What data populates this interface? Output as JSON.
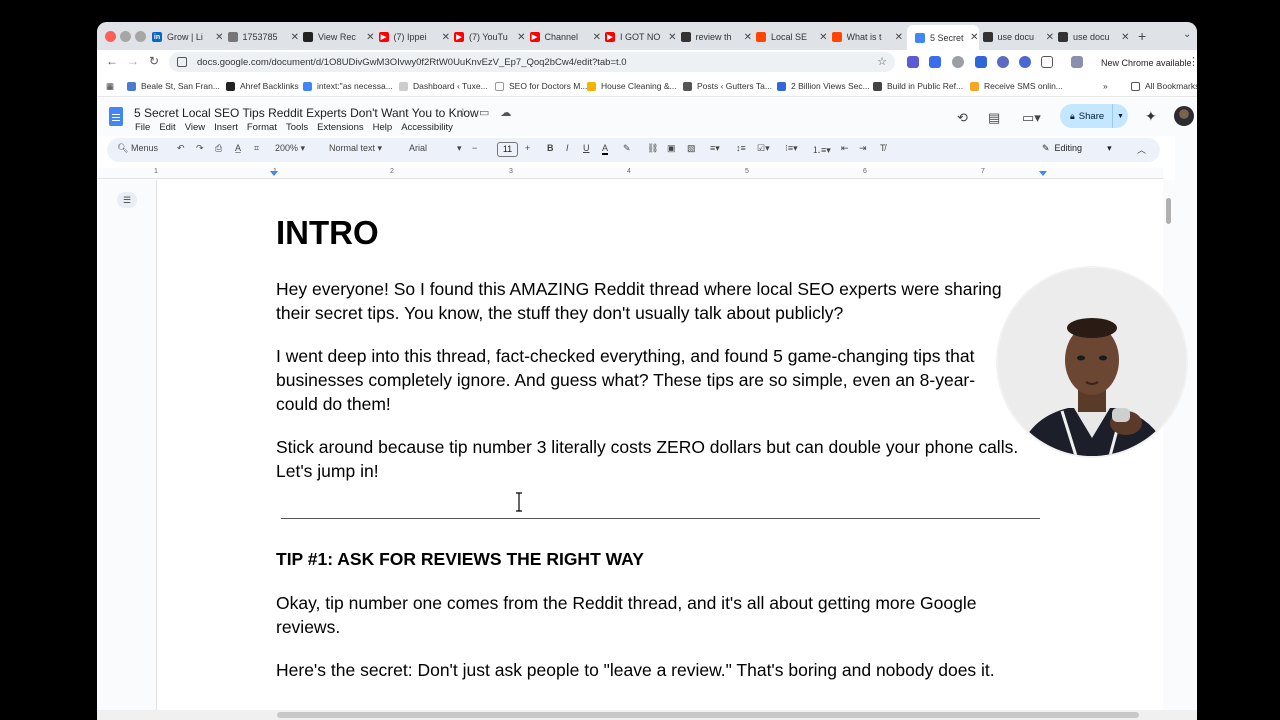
{
  "browser": {
    "tabs": [
      {
        "label": "Grow | Li",
        "icon": "linkedin-icon",
        "color": "#0a66c2",
        "glyph": "in"
      },
      {
        "label": "1753785",
        "icon": "globe-icon",
        "color": "#777777",
        "glyph": ""
      },
      {
        "label": "View Rec",
        "icon": "dark-site-icon",
        "color": "#222222",
        "glyph": ""
      },
      {
        "label": "(7) Ippei",
        "icon": "youtube-icon",
        "color": "#ff0000",
        "glyph": "▶"
      },
      {
        "label": "(7) YouTu",
        "icon": "youtube-icon",
        "color": "#ff0000",
        "glyph": "▶"
      },
      {
        "label": "Channel",
        "icon": "youtube-icon",
        "color": "#ff0000",
        "glyph": "▶"
      },
      {
        "label": "I GOT NO",
        "icon": "youtube-icon",
        "color": "#ff0000",
        "glyph": "▶"
      },
      {
        "label": "review th",
        "icon": "openai-icon",
        "color": "#333333",
        "glyph": ""
      },
      {
        "label": "Local SE",
        "icon": "reddit-icon",
        "color": "#ff4500",
        "glyph": ""
      },
      {
        "label": "What is t",
        "icon": "reddit-icon",
        "color": "#ff4500",
        "glyph": ""
      },
      {
        "label": "5 Secret",
        "icon": "google-docs-icon",
        "color": "#4285f4",
        "glyph": "",
        "active": true
      },
      {
        "label": "use docu",
        "icon": "openai-icon",
        "color": "#333333",
        "glyph": ""
      },
      {
        "label": "use docu",
        "icon": "openai-icon",
        "color": "#333333",
        "glyph": ""
      }
    ],
    "url": "docs.google.com/document/d/1O8UDivGwM3OIvwy0f2RtW0UuKnvEzV_Ep7_Qoq2bCw4/edit?tab=t.0",
    "update_label": "New Chrome available",
    "bookmarks": [
      {
        "label": "Beale St, San Fran...",
        "color": "#4a7bd0"
      },
      {
        "label": "Ahref Backlinks",
        "color": "#222222"
      },
      {
        "label": "intext:\"as necessa...",
        "color": "#4285f4"
      },
      {
        "label": "Dashboard ‹ Tuxe...",
        "color": "#cccccc"
      },
      {
        "label": "SEO for Doctors M...",
        "color": "#ffffff"
      },
      {
        "label": "House Cleaning &...",
        "color": "#f2b400"
      },
      {
        "label": "Posts ‹ Gutters Ta...",
        "color": "#555555"
      },
      {
        "label": "2 Billion Views Sec...",
        "color": "#3367d6"
      },
      {
        "label": "Build in Public Ref...",
        "color": "#444444"
      },
      {
        "label": "Receive SMS onlin...",
        "color": "#f5a623"
      }
    ],
    "all_bookmarks": "All Bookmarks"
  },
  "docs": {
    "title": "5 Secret Local SEO Tips Reddit Experts Don't Want You to Know",
    "menus": [
      "File",
      "Edit",
      "View",
      "Insert",
      "Format",
      "Tools",
      "Extensions",
      "Help",
      "Accessibility"
    ],
    "share_label": "Share",
    "toolbar": {
      "search_label": "Menus",
      "zoom": "200%",
      "style": "Normal text",
      "font": "Arial",
      "font_size": "11",
      "mode": "Editing"
    },
    "ruler_numbers": [
      "1",
      "1",
      "2",
      "3",
      "4",
      "5",
      "6",
      "7"
    ]
  },
  "document": {
    "heading": "INTRO",
    "paragraphs": [
      [
        "Hey everyone! So I found this AMAZING Reddit thread where local SEO experts were sharing",
        "their secret tips. You know, the stuff they don't usually talk about publicly?"
      ],
      [
        "I went deep into this thread, fact-checked everything, and found 5 game-changing tips that",
        "businesses completely ignore. And guess what? These tips are so simple, even an 8-year-",
        "could do them!"
      ],
      [
        "Stick around because tip number 3 literally costs ZERO dollars but can double your phone calls.",
        "Let's jump in!"
      ]
    ],
    "tip1_heading": "TIP #1: ASK FOR REVIEWS THE RIGHT WAY",
    "tip1_paragraphs": [
      [
        "Okay, tip number one comes from the Reddit thread, and it's all about getting more Google",
        "reviews."
      ],
      [
        "Here's the secret: Don't just ask people to \"leave a review.\" That's boring and nobody does it."
      ]
    ]
  },
  "colors": {
    "accent": "#4285f4",
    "share_bg": "#c2e7ff",
    "toolbar_bg": "#edf2fa"
  }
}
